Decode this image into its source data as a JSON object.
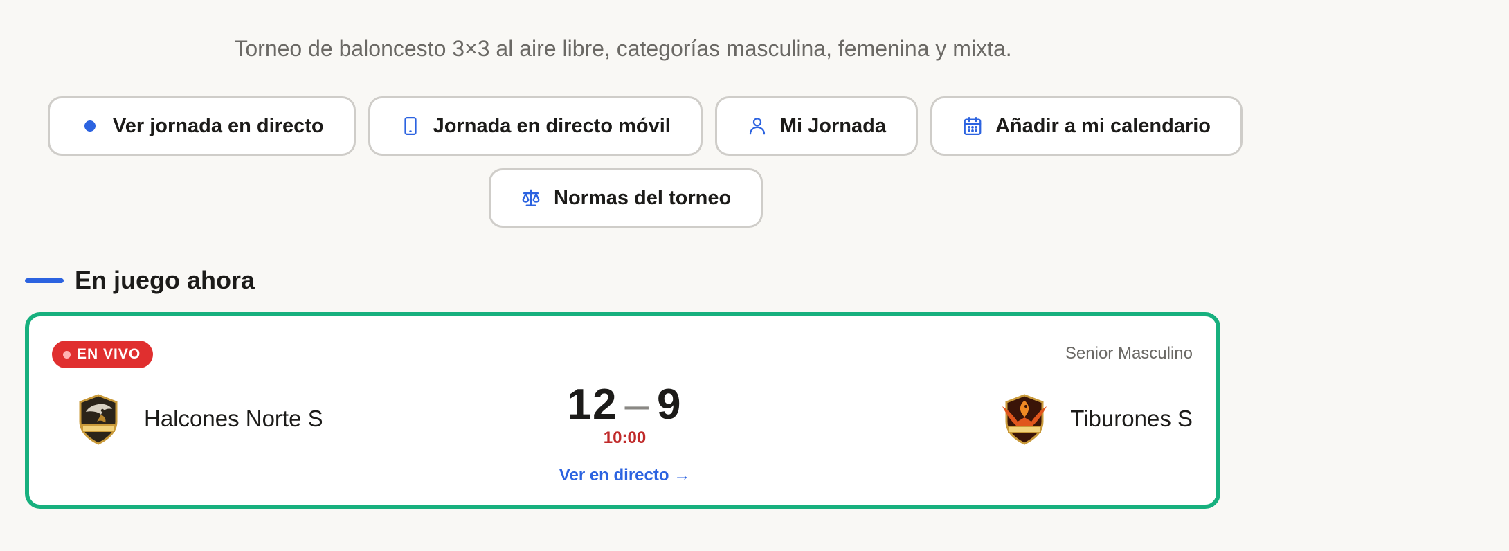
{
  "tournament": {
    "description": "Torneo de baloncesto 3×3 al aire libre, categorías masculina, femenina y mixta."
  },
  "actions": [
    {
      "label": "Ver jornada en directo",
      "icon": "live-dot-icon"
    },
    {
      "label": "Jornada en directo móvil",
      "icon": "mobile-phone-icon"
    },
    {
      "label": "Mi Jornada",
      "icon": "user-icon"
    },
    {
      "label": "Añadir a mi calendario",
      "icon": "calendar-icon"
    },
    {
      "label": "Normas del torneo",
      "icon": "scales-icon"
    }
  ],
  "live_section": {
    "title": "En juego ahora",
    "match": {
      "badge": "EN VIVO",
      "category": "Senior Masculino",
      "home": {
        "name": "Halcones Norte S",
        "score": "12",
        "logo": "eagle-logo-icon"
      },
      "away": {
        "name": "Tiburones S",
        "score": "9",
        "logo": "phoenix-logo-icon"
      },
      "separator": "–",
      "clock": "10:00",
      "link": "Ver en directo →"
    }
  },
  "colors": {
    "accent": "#2c63e0",
    "live_red": "#e02f2f",
    "card_border": "#17b07e",
    "background": "#f9f8f5"
  }
}
